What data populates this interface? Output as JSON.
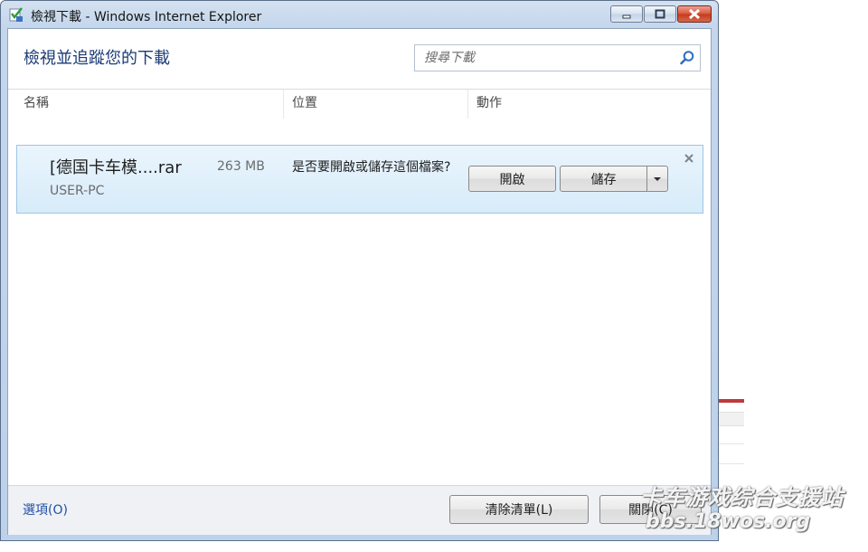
{
  "window": {
    "title": "檢視下載 - Windows Internet Explorer",
    "icon": "ie-download-icon"
  },
  "header": {
    "heading": "檢視並追蹤您的下載",
    "search_placeholder": "搜尋下載"
  },
  "columns": {
    "name": "名稱",
    "location": "位置",
    "action": "動作"
  },
  "download": {
    "name": "[德国卡车模....rar",
    "size": "263 MB",
    "source": "USER-PC",
    "question": "是否要開啟或儲存這個檔案?",
    "open_label": "開啟",
    "save_label": "儲存"
  },
  "footer": {
    "options_label": "選項(O)",
    "clear_label": "清除清單(L)",
    "close_label": "關閉(C)"
  },
  "watermark": {
    "line1": "卡车游戏综合支援站",
    "line2": "bbs.18wos.org"
  },
  "colors": {
    "heading": "#1b3b76",
    "link": "#1f4fa8",
    "item_bg": "#d7ebf9",
    "close_button": "#c23a1e"
  }
}
